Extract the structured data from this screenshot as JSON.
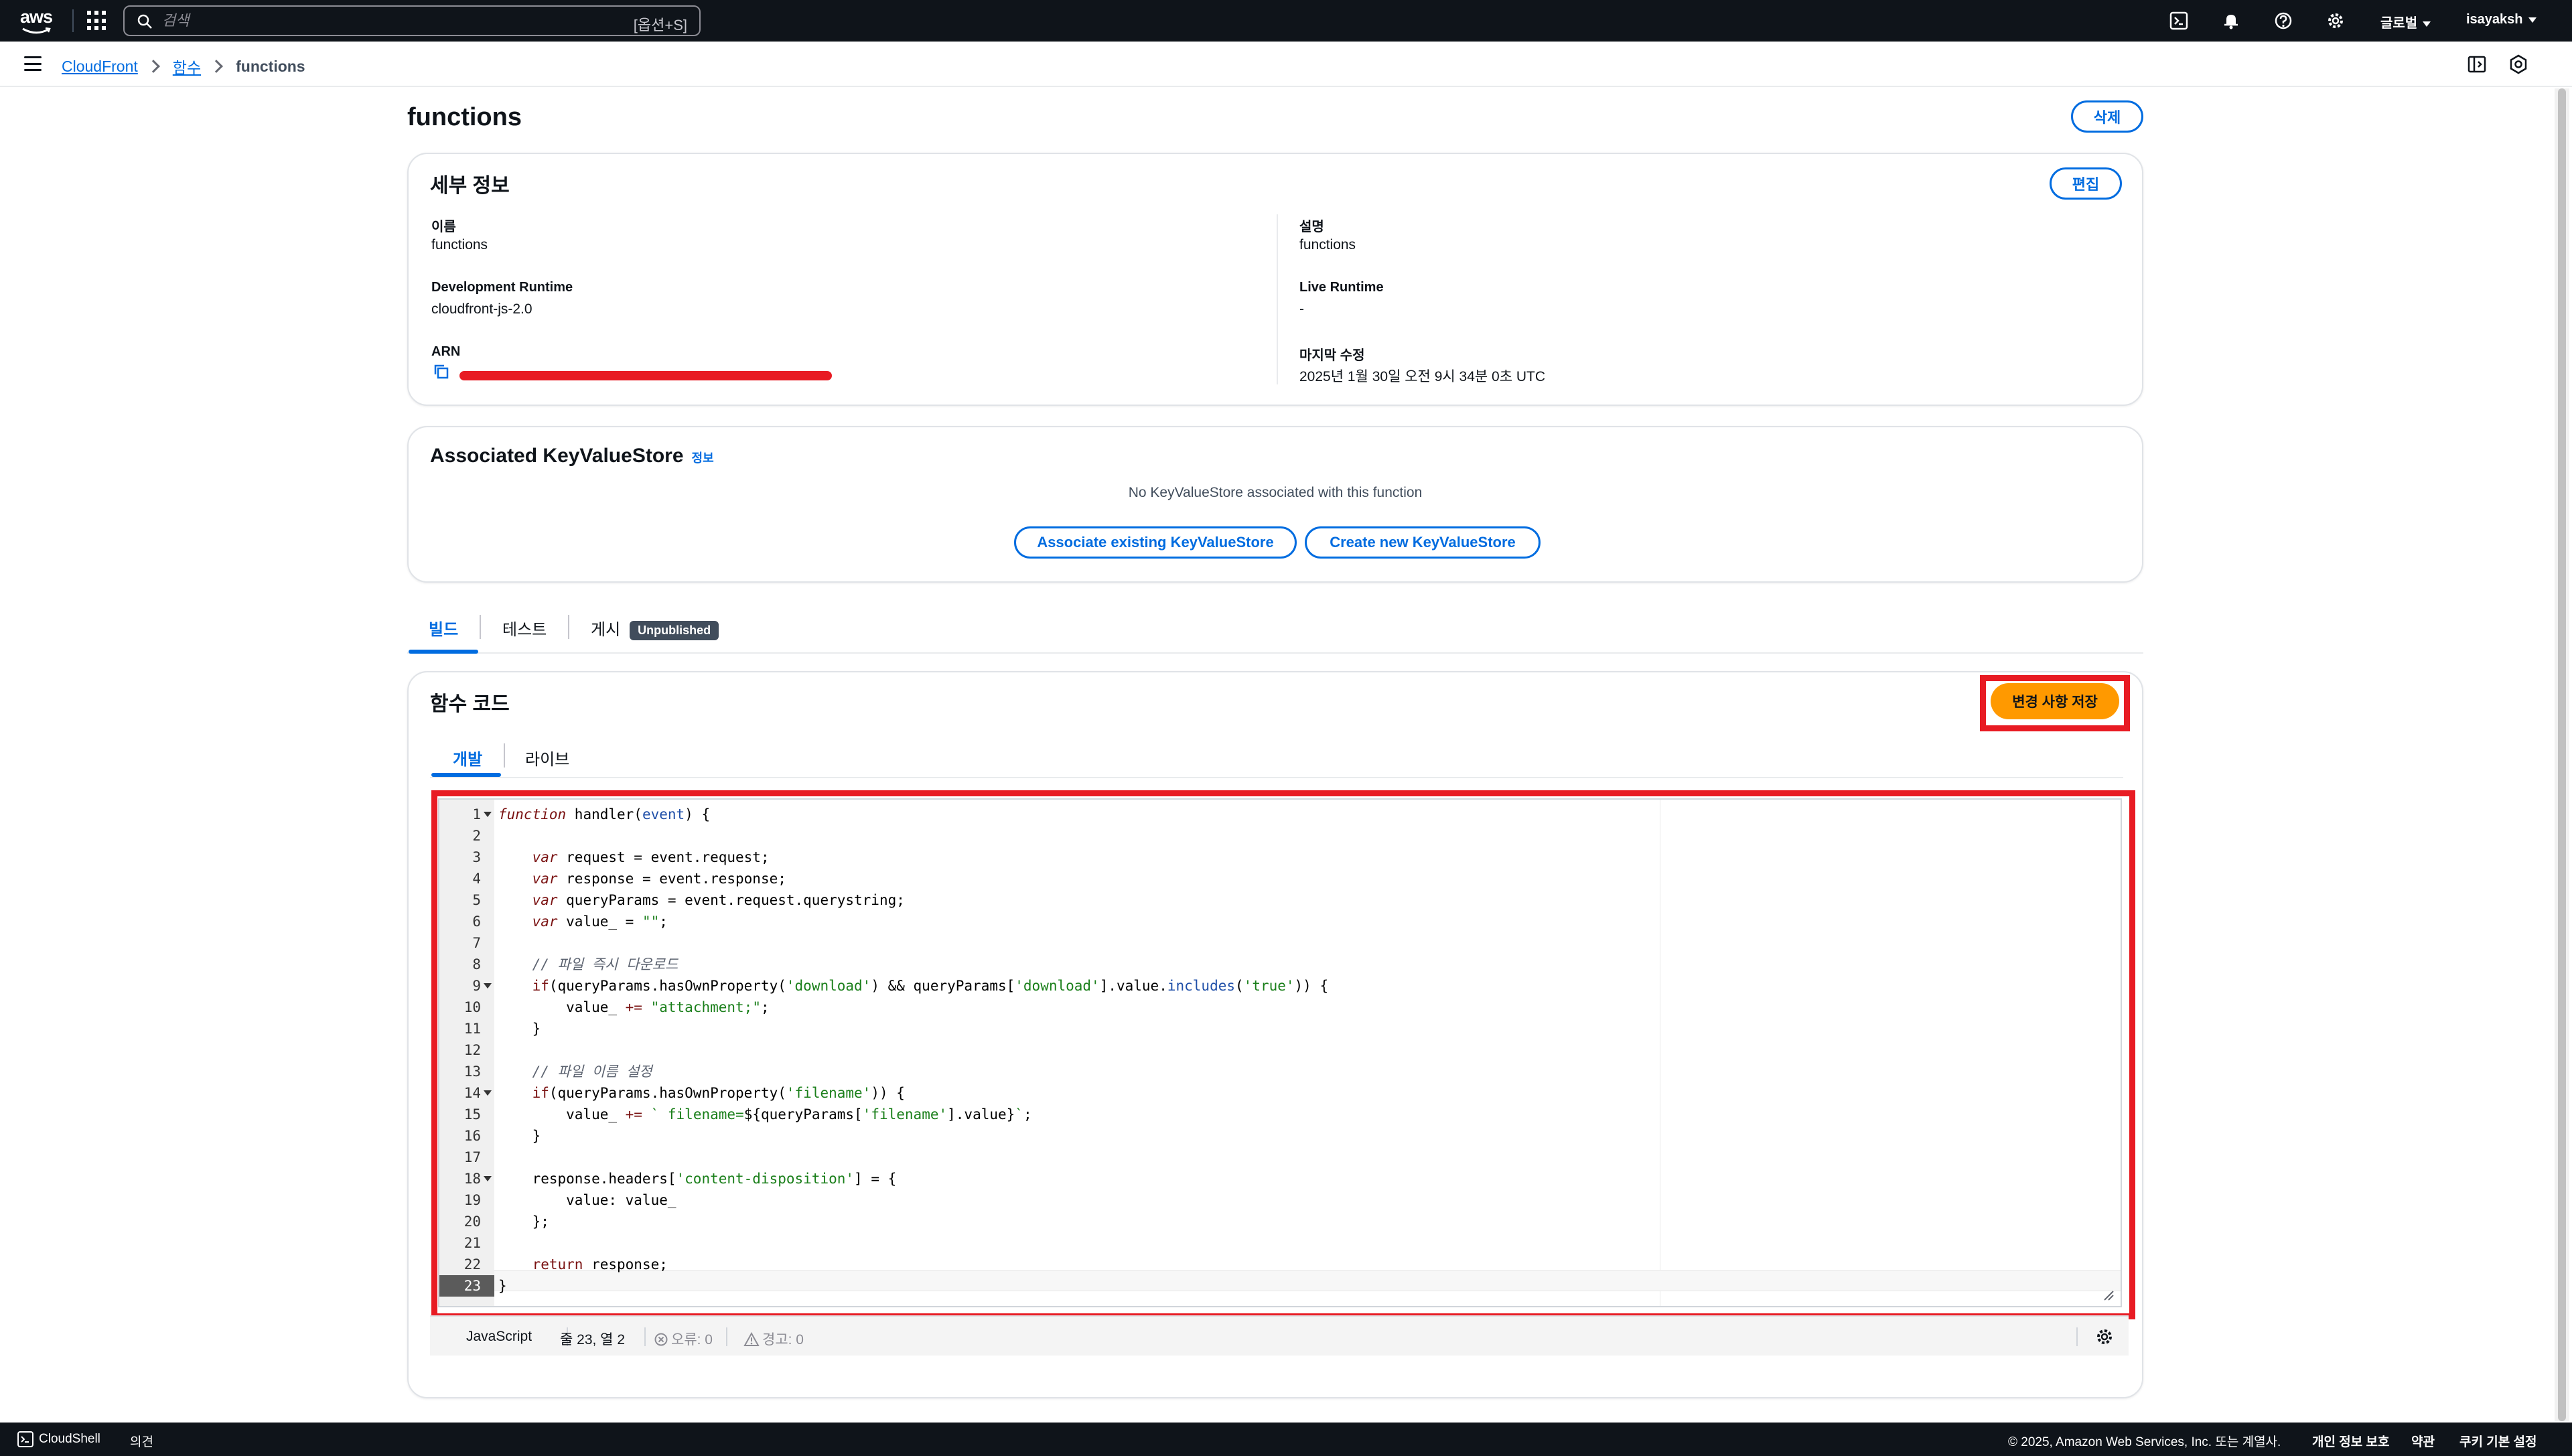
{
  "topnav": {
    "logo_text": "aws",
    "search_placeholder": "검색",
    "search_shortcut": "[옵션+S]",
    "region": "글로벌",
    "user": "isayaksh"
  },
  "breadcrumb": {
    "items": [
      "CloudFront",
      "함수"
    ],
    "current": "functions"
  },
  "page": {
    "title": "functions",
    "delete_label": "삭제"
  },
  "details": {
    "title": "세부 정보",
    "edit_label": "편집",
    "name_label": "이름",
    "name_value": "functions",
    "dev_runtime_label": "Development Runtime",
    "dev_runtime_value": "cloudfront-js-2.0",
    "arn_label": "ARN",
    "desc_label": "설명",
    "desc_value": "functions",
    "live_runtime_label": "Live Runtime",
    "live_runtime_value": "-",
    "modified_label": "마지막 수정",
    "modified_value": "2025년 1월 30일 오전 9시 34분 0초 UTC"
  },
  "kvs": {
    "title": "Associated KeyValueStore",
    "info": "정보",
    "empty_message": "No KeyValueStore associated with this function",
    "associate_label": "Associate existing KeyValueStore",
    "create_label": "Create new KeyValueStore"
  },
  "tabs": {
    "build": "빌드",
    "test": "테스트",
    "publish": "게시",
    "publish_badge": "Unpublished"
  },
  "function_code": {
    "title": "함수 코드",
    "save_label": "변경 사항 저장",
    "subtab_dev": "개발",
    "subtab_live": "라이브"
  },
  "editor": {
    "line_numbers": [
      "1",
      "2",
      "3",
      "4",
      "5",
      "6",
      "7",
      "8",
      "9",
      "10",
      "11",
      "12",
      "13",
      "14",
      "15",
      "16",
      "17",
      "18",
      "19",
      "20",
      "21",
      "22",
      "23"
    ],
    "active_line": "23"
  },
  "statusbar": {
    "language": "JavaScript",
    "position": "줄 23, 열 2",
    "errors": "오류: 0",
    "warnings": "경고: 0"
  },
  "footer": {
    "cloudshell": "CloudShell",
    "feedback": "의견",
    "copyright": "© 2025, Amazon Web Services, Inc. 또는 계열사.",
    "privacy": "개인 정보 보호",
    "terms": "약관",
    "cookies": "쿠키 기본 설정"
  },
  "colors": {
    "accent": "#006ce0",
    "primary_button": "#ff9900",
    "highlight": "#e81b23",
    "nav_bg": "#0f141a"
  }
}
